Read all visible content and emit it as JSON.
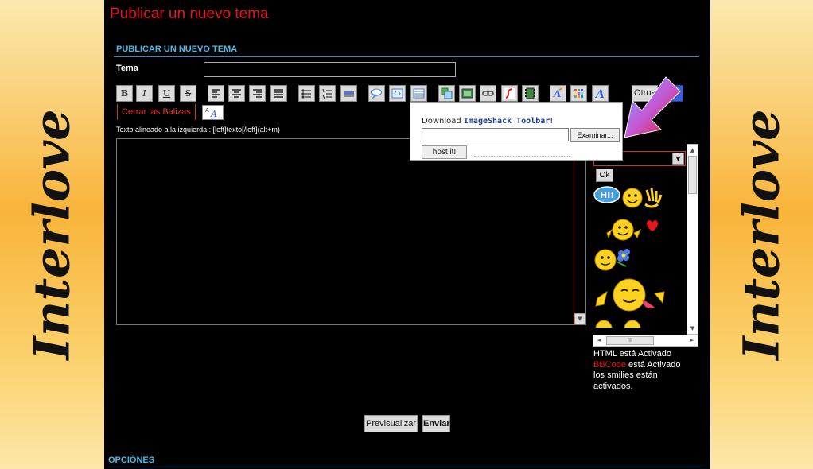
{
  "page": {
    "title": "Publicar un nuevo tema",
    "section_title": "PUBLICAR UN NUEVO TEMA",
    "topic_label": "Tema",
    "topic_value": "",
    "options_title": "OPCIÓNES"
  },
  "branding": {
    "left_logo_text": "Interlove",
    "right_logo_text": "Interlove"
  },
  "toolbar": {
    "bold": "B",
    "italic": "I",
    "underline": "U",
    "strike": "S",
    "others_label": "Otros",
    "help_label": "?",
    "close_tags_label": "Cerrar las Balizas",
    "font_size_label": "A",
    "hint": "Texto alineado a la izquierda : [left]texto[/left](alt+m)"
  },
  "editor": {
    "message_value": ""
  },
  "smilies": {
    "select_value": "",
    "ok_label": "Ok",
    "scroll_thumb": "III"
  },
  "status": {
    "html": "HTML está Activado",
    "bbcode_link": "BBCode",
    "bbcode_rest": " está Activado",
    "smilies": "los smilies están activados."
  },
  "buttons": {
    "preview": "Previsualizar",
    "send": "Enviar"
  },
  "popup": {
    "download_prefix": "Download ",
    "download_brand": "ImageShack Toolbar",
    "download_suffix": "!",
    "browse_label": "Examinar...",
    "host_label": "host it!"
  },
  "colors": {
    "accent_title": "#e8161b",
    "section_blue": "#4cb8e6",
    "background": "#000000",
    "sidebar_orange": "#f9b43a"
  },
  "icons": [
    "bold-icon",
    "italic-icon",
    "underline-icon",
    "strike-icon",
    "align-left-icon",
    "align-center-icon",
    "align-right-icon",
    "justify-icon",
    "list-icon",
    "ordered-list-icon",
    "hr-icon",
    "quote-icon",
    "code-icon",
    "table-icon",
    "image-icon",
    "upload-image-icon",
    "link-icon",
    "flash-icon",
    "video-icon",
    "color-icon",
    "grid-icon",
    "font-icon",
    "help-icon"
  ]
}
